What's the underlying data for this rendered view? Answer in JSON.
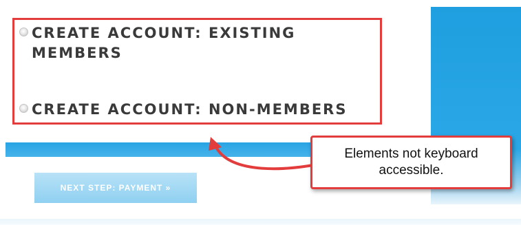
{
  "options": [
    {
      "label": "CREATE ACCOUNT: EXISTING\nMEMBERS"
    },
    {
      "label": "CREATE ACCOUNT: NON-MEMBERS"
    }
  ],
  "next_button": {
    "label": "NEXT STEP: PAYMENT »"
  },
  "annotation": {
    "text": "Elements not keyboard accessible."
  },
  "colors": {
    "highlight": "#e23c3c",
    "brand_blue": "#28a3e4",
    "label_text": "#3a3a3a",
    "button_bg": "#a5d9f4"
  }
}
